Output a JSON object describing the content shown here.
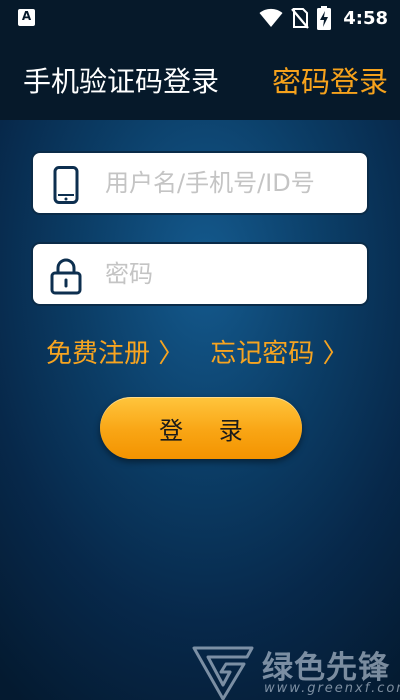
{
  "status_bar": {
    "app_icon_glyph": "A",
    "time": "4:58",
    "icons": [
      "wifi-icon",
      "no-sim-icon",
      "battery-charging-icon"
    ]
  },
  "app_bar": {
    "title": "手机验证码登录",
    "action_label": "密码登录"
  },
  "form": {
    "username": {
      "icon": "phone-icon",
      "placeholder": "用户名/手机号/ID号",
      "value": ""
    },
    "password": {
      "icon": "lock-icon",
      "placeholder": "密码",
      "value": ""
    },
    "register_link": "免费注册 〉",
    "forgot_link": "忘记密码 〉",
    "login_button": "登 录"
  },
  "watermark": {
    "text": "绿色先锋",
    "url": "www.greenxf.com"
  },
  "colors": {
    "accent": "#f7a420",
    "header_bg": "#06192a",
    "background": "#0b3d66",
    "button_gradient": [
      "#ffc53d",
      "#f39300"
    ]
  }
}
